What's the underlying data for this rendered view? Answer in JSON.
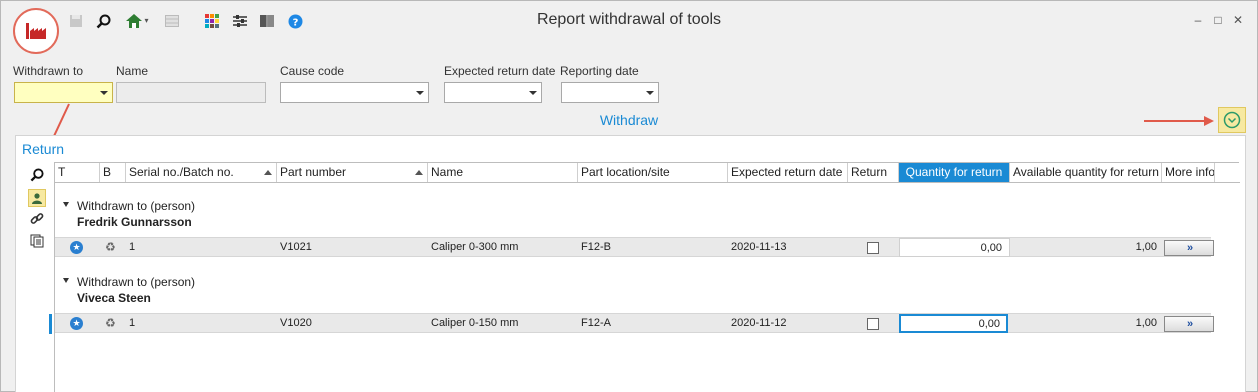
{
  "window": {
    "title": "Report withdrawal of tools",
    "minimize_glyph": "–",
    "maximize_glyph": "□",
    "close_glyph": "✕"
  },
  "toolbar": {
    "icons": [
      "app-logo-icon",
      "save-icon",
      "search-icon",
      "home-icon",
      "grid-icon",
      "color-palette-icon",
      "settings-sliders-icon",
      "book-icon",
      "help-icon"
    ],
    "colors": {
      "accent": "#1a8ad4",
      "logo": "#c62828"
    }
  },
  "filters": {
    "withdrawn_to": {
      "label": "Withdrawn to",
      "value": ""
    },
    "name": {
      "label": "Name",
      "value": ""
    },
    "cause_code": {
      "label": "Cause code",
      "value": ""
    },
    "expected_return_date": {
      "label": "Expected return date",
      "value": ""
    },
    "reporting_date": {
      "label": "Reporting date",
      "value": ""
    }
  },
  "withdraw_section": {
    "label": "Withdraw"
  },
  "return_section": {
    "title": "Return",
    "side_icons": [
      "search-icon",
      "person-icon",
      "link-icon",
      "list-icon"
    ],
    "columns": [
      "T",
      "B",
      "Serial no./Batch no.",
      "Part number",
      "Name",
      "Part location/site",
      "Expected return date",
      "Return",
      "Quantity for return",
      "Available quantity for return",
      "More info"
    ],
    "groups": [
      {
        "title": "Withdrawn to  (person)",
        "name": "Fredrik Gunnarsson",
        "row": {
          "serial": "1",
          "part_number": "V1021",
          "name": "Caliper 0-300 mm",
          "location": "F12-B",
          "expected_return": "2020-11-13",
          "return_checked": false,
          "quantity_for_return": "0,00",
          "available_quantity": "1,00",
          "more_info": "»"
        }
      },
      {
        "title": "Withdrawn to  (person)",
        "name": "Viveca Steen",
        "row": {
          "serial": "1",
          "part_number": "V1020",
          "name": "Caliper 0-150 mm",
          "location": "F12-A",
          "expected_return": "2020-11-12",
          "return_checked": false,
          "quantity_for_return": "0,00",
          "available_quantity": "1,00",
          "more_info": "»"
        }
      }
    ]
  }
}
